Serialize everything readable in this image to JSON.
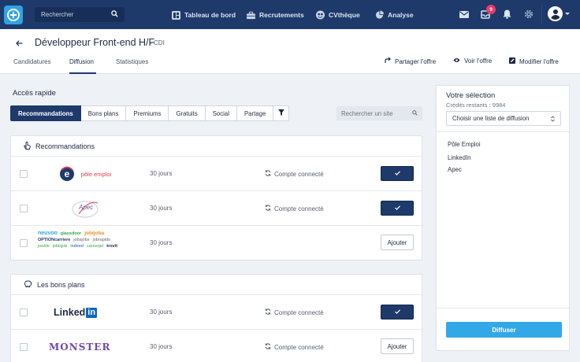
{
  "nav": {
    "search_placeholder": "Rechercher",
    "links": [
      "Tableau de bord",
      "Recrutements",
      "CVthèque",
      "Analyse"
    ],
    "notification_count": "9",
    "colors": {
      "bar": "#1e3a6b",
      "accent": "#2fa3e6",
      "badge": "#e93c6c"
    }
  },
  "header": {
    "back_icon": "arrow-left-icon",
    "job_title": "Développeur Front-end H/F",
    "job_type": "• CDI",
    "tabs": [
      "Candidatures",
      "Diffusion",
      "Statistiques"
    ],
    "active_tab": "Diffusion",
    "actions": [
      "Partager l'offre",
      "Voir l'offre",
      "Modifier l'offre"
    ]
  },
  "quick_access": {
    "title": "Accès rapide",
    "filters": [
      "Recommandations",
      "Bons plans",
      "Premiums",
      "Gratuits",
      "Social",
      "Partage"
    ],
    "active_filter": "Recommandations",
    "site_search_placeholder": "Rechercher un site"
  },
  "sections": [
    {
      "title": "Recommandations",
      "rows": [
        {
          "logo": "pôle emploi",
          "duration": "30 jours",
          "status": "Compte connecté",
          "selected": true
        },
        {
          "logo": "Apec",
          "duration": "30 jours",
          "status": "",
          "selected": true
        },
        {
          "logo_group": [
            "neuvoo",
            "glassdoor",
            "jobijoba",
            "OPTIONcarriere",
            "jobsjobs",
            "jobrapido",
            "jooble",
            "jobisjob",
            "indeed",
            "careerjet",
            "trovit"
          ],
          "duration": "30 jours",
          "status": "",
          "selected": false,
          "add_label": "Ajouter"
        }
      ]
    },
    {
      "title": "Les bons plans",
      "rows": [
        {
          "logo": "Linked",
          "logo_suffix": "in",
          "duration": "30 jours",
          "status": "Compte connecté",
          "selected": true
        },
        {
          "logo": "MONSTER",
          "duration": "30 jours",
          "status": "Compte connecté",
          "selected": false,
          "add_label": "Ajouter"
        }
      ]
    }
  ],
  "selection": {
    "title": "Votre sélection",
    "credits": "Crédits restants : 9984",
    "list_placeholder": "Choisir une liste de diffusion",
    "items": [
      "Pôle Emploi",
      "LinkedIn",
      "Apec"
    ],
    "submit_label": "Diffuser"
  }
}
